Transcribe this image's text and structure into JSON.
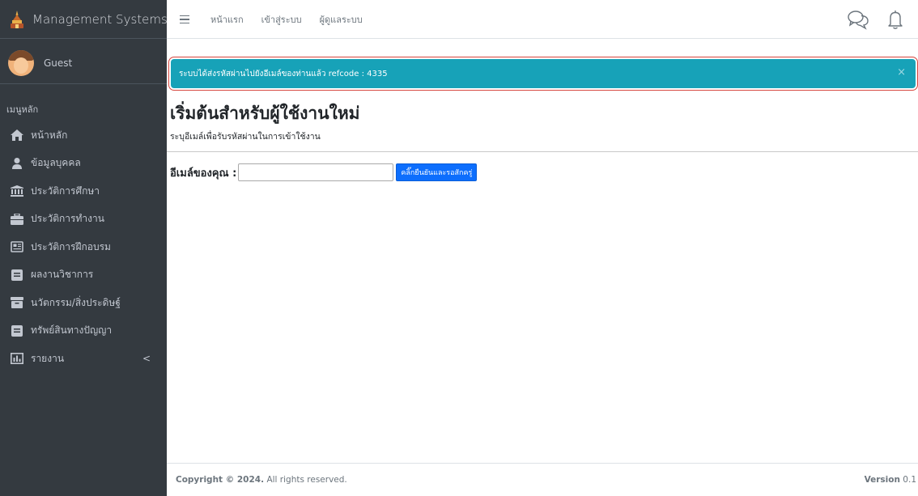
{
  "brand": {
    "title": "Management Systems",
    "logo_icon": "temple-logo-icon"
  },
  "user": {
    "name": "Guest",
    "avatar_icon": "user-avatar-icon"
  },
  "sidebar": {
    "header": "เมนูหลัก",
    "items": [
      {
        "label": "หน้าหลัก",
        "icon": "home-icon"
      },
      {
        "label": "ข้อมูลบุคคล",
        "icon": "user-icon"
      },
      {
        "label": "ประวัติการศึกษา",
        "icon": "university-icon"
      },
      {
        "label": "ประวัติการทำงาน",
        "icon": "briefcase-icon"
      },
      {
        "label": "ประวัติการฝึกอบรม",
        "icon": "newspaper-icon"
      },
      {
        "label": "ผลงานวิชาการ",
        "icon": "book-icon"
      },
      {
        "label": "นวัตกรรม/สิ่งประดิษฐ์",
        "icon": "archive-icon"
      },
      {
        "label": "ทรัพย์สินทางปัญญา",
        "icon": "book-icon"
      },
      {
        "label": "รายงาน",
        "icon": "chart-icon",
        "caret": "<"
      }
    ]
  },
  "topbar": {
    "links": [
      "หน้าแรก",
      "เข้าสู่ระบบ",
      "ผู้ดูแลระบบ"
    ],
    "icons": [
      "chat-icon",
      "bell-icon"
    ]
  },
  "alert": {
    "text": "ระบบได้ส่งรหัสผ่านไปยังอีเมล์ของท่านแล้ว refcode : 4335",
    "close": "×",
    "color": "#17a2b8"
  },
  "page": {
    "title": "เริ่มต้นสำหรับผู้ใช้งานใหม่",
    "subtitle": "ระบุอีเมล์เพื่อรับรหัสผ่านในการเข้าใช้งาน"
  },
  "form": {
    "email_label": "อีเมล์ของคุณ :",
    "email_value": "",
    "submit_label": "คลิ๊กยืนยันและรอสักครู่"
  },
  "footer": {
    "copyright_bold": "Copyright © 2024.",
    "copyright_rest": "All rights reserved.",
    "version_label": "Version",
    "version_value": "0.1"
  },
  "colors": {
    "sidebar_bg": "#343a40",
    "alert_bg": "#17a2b8",
    "alert_border": "#d6453d",
    "button_bg": "#0d6efd"
  }
}
